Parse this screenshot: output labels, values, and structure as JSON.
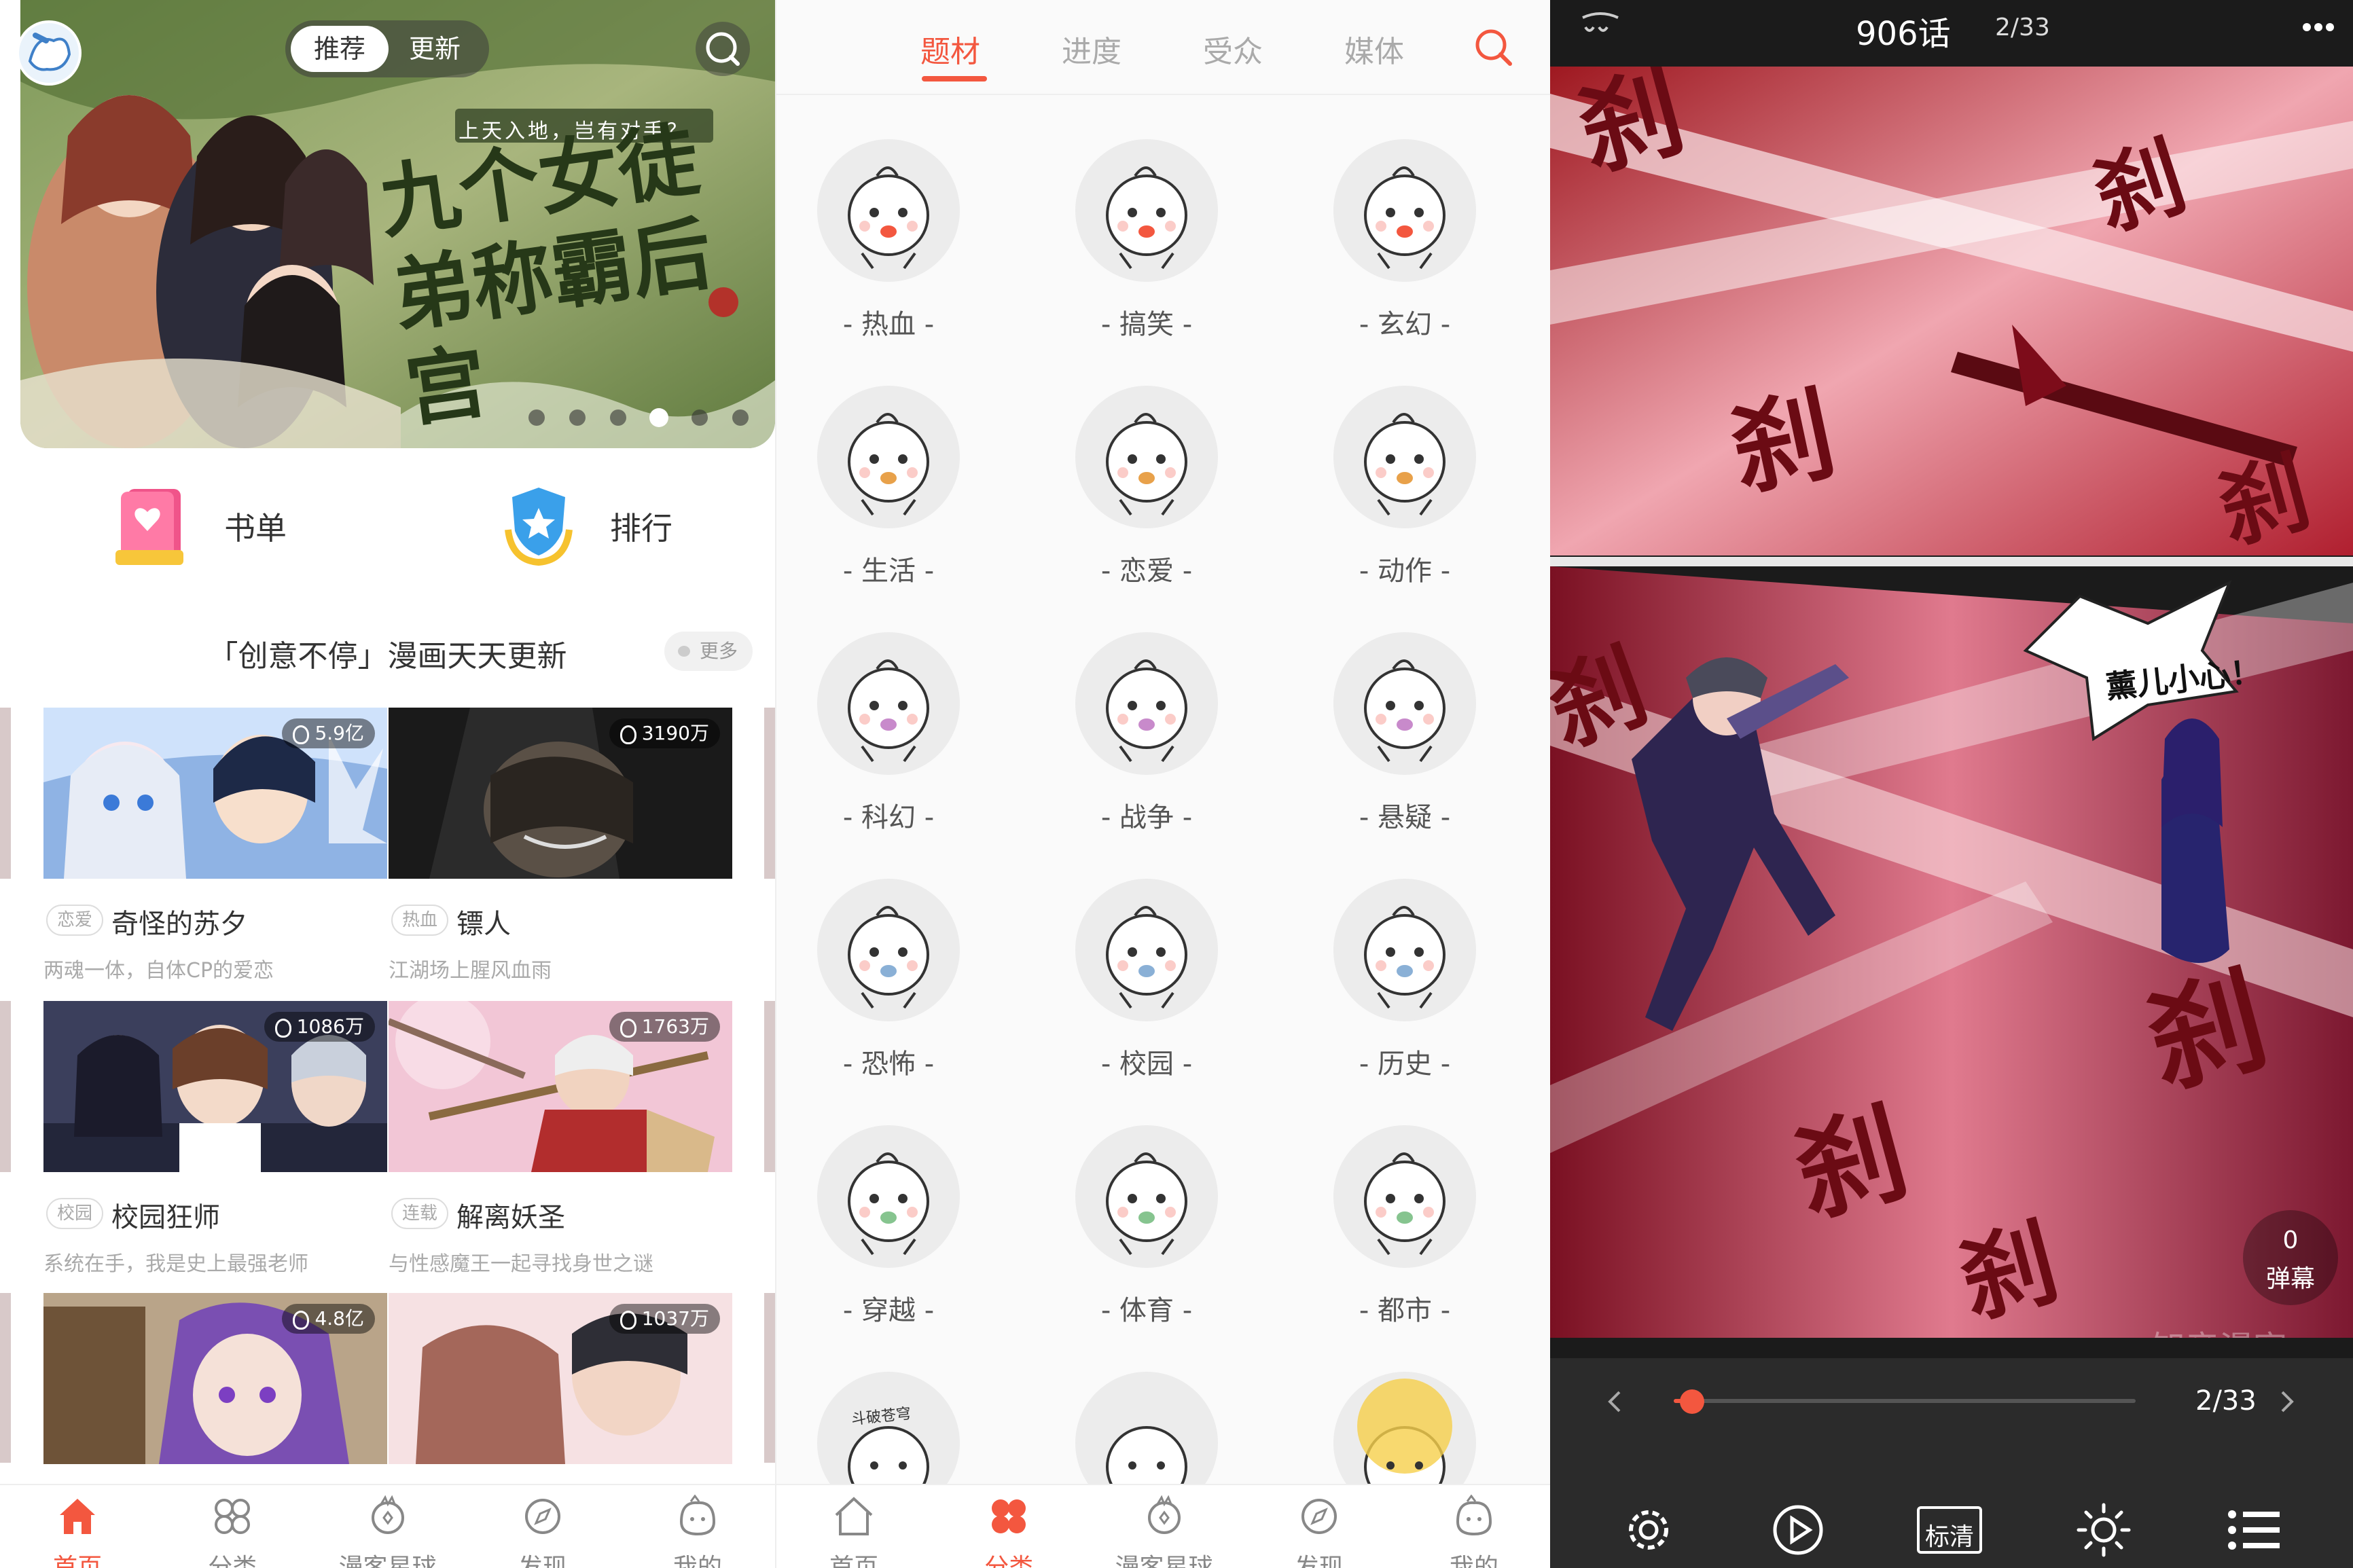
{
  "home": {
    "segment": {
      "recommend": "推荐",
      "update": "更新"
    },
    "banner_slogan": "上天入地，岂有对手？",
    "banner_title": "九个女徒弟称霸后宫",
    "quick_links": [
      {
        "label": "书单"
      },
      {
        "label": "排行"
      }
    ],
    "section_title": "「创意不停」漫画天天更新",
    "more_label": "更多",
    "cards": [
      {
        "count": "5.9亿",
        "tag": "恋爱",
        "name": "奇怪的苏夕",
        "desc": "两魂一体，自体CP的爱恋"
      },
      {
        "count": "3190万",
        "tag": "热血",
        "name": "镖人",
        "desc": "江湖场上腥风血雨"
      },
      {
        "count": "1086万",
        "tag": "校园",
        "name": "校园狂师",
        "desc": "系统在手，我是史上最强老师"
      },
      {
        "count": "1763万",
        "tag": "连载",
        "name": "解离妖圣",
        "desc": "与性感魔王一起寻找身世之谜"
      },
      {
        "count": "4.8亿"
      },
      {
        "count": "1037万"
      }
    ],
    "tabbar": [
      "首页",
      "分类",
      "漫客星球",
      "发现",
      "我的"
    ]
  },
  "category": {
    "tabs": [
      "题材",
      "进度",
      "受众",
      "媒体"
    ],
    "genres": [
      "热血",
      "搞笑",
      "玄幻",
      "生活",
      "恋爱",
      "动作",
      "科幻",
      "战争",
      "悬疑",
      "恐怖",
      "校园",
      "历史",
      "穿越",
      "体育",
      "都市"
    ],
    "bottom_row_sign": "斗破苍穹",
    "tabbar": [
      "首页",
      "分类",
      "漫客星球",
      "发现",
      "我的"
    ]
  },
  "reader": {
    "chapter": "906话",
    "page": "2/33",
    "progress": 0.04,
    "speech_bubble": "薰儿小心！",
    "sfx": "刹",
    "danmu_count": "0",
    "danmu_label": "弹幕",
    "watermark": "知音漫客",
    "quality_label": "标清"
  },
  "colors": {
    "accent": "#f3573f",
    "reader_bg": "#1b1b1b"
  }
}
